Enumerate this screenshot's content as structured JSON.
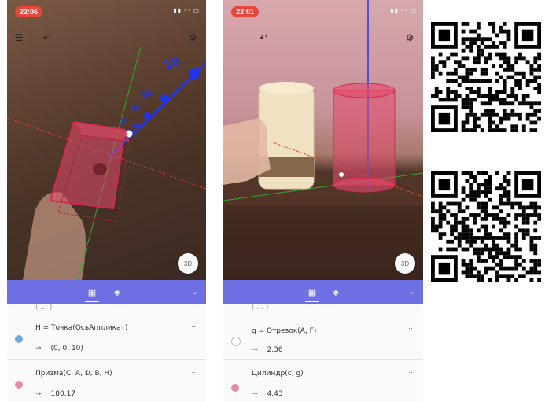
{
  "left_phone": {
    "status_time": "22:06",
    "status_icons": "▮▮ ◠ ▭",
    "three_d_label": "3D",
    "menu_icon": "menu-icon",
    "undo_icon": "undo-icon",
    "settings_icon": "gear-icon",
    "axis_labels": [
      "18",
      "16",
      "14",
      "12"
    ],
    "algebra": {
      "partial_top": "( ... )",
      "rows": [
        {
          "expr": "H = Точка(ОсьАппликат)",
          "result": "(0, 0, 10)",
          "color": "#6fa8dc",
          "menu": "⋯"
        },
        {
          "expr": "Призма(C, A, D, B, H)",
          "result": "180.17",
          "color": "#e48ea2",
          "menu": "⋯"
        }
      ]
    }
  },
  "right_phone": {
    "status_time": "22:01",
    "status_icons": "▮▮ ◠ ▭",
    "three_d_label": "3D",
    "algebra": {
      "partial_top": "( ... )",
      "rows": [
        {
          "expr": "g = Отрезок(A, F)",
          "result": "2.36",
          "color": "#ffffff",
          "menu": "⋯"
        },
        {
          "expr": "Цилиндр(c, g)",
          "result": "4.43",
          "color": "#e48ea2",
          "menu": "⋯"
        }
      ]
    }
  },
  "toolbar": {
    "color": "#6e6fe3",
    "tools": [
      "calculator-icon",
      "shapes-icon"
    ],
    "chevron": "⌄"
  },
  "qr_codes": [
    "qr-code-top",
    "qr-code-bottom"
  ]
}
